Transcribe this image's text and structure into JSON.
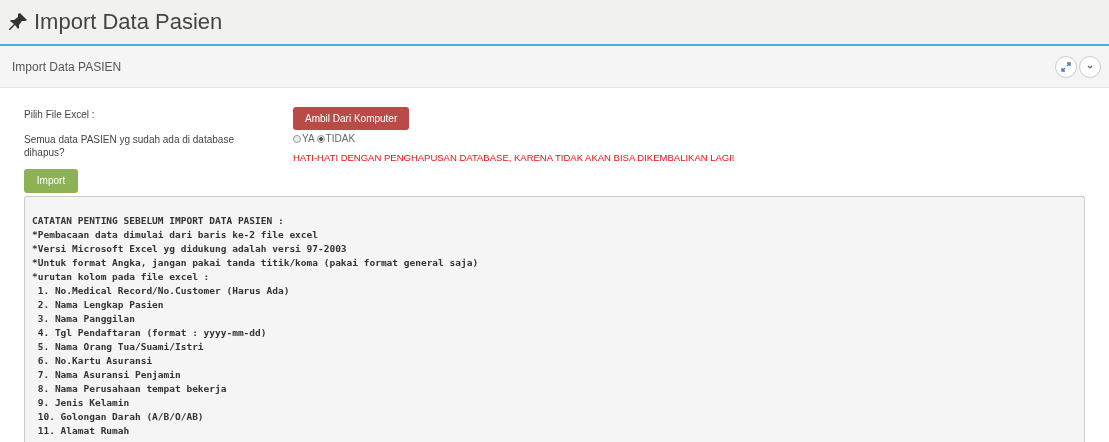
{
  "page_title": "Import Data Pasien",
  "panel": {
    "title": "Import Data PASIEN",
    "file_label": "Pilih File Excel :",
    "file_button": "Ambil Dari Komputer",
    "delete_label": "Semua data PASIEN yg sudah ada di database dihapus?",
    "delete_options": [
      {
        "label": "YA",
        "selected": false
      },
      {
        "label": "TIDAK",
        "selected": true
      }
    ],
    "warning": "HATI-HATI DENGAN PENGHAPUSAN DATABASE, KARENA TIDAK AKAN BISA DIKEMBALIKAN LAGI!",
    "import_button": "Import",
    "notes": {
      "heading": "CATATAN PENTING SEBELUM IMPORT DATA PASIEN :",
      "lines": [
        "*Pembacaan data dimulai dari baris ke-2 file excel",
        "*Versi Microsoft Excel yg didukung adalah versi 97-2003",
        "*Untuk format Angka, jangan pakai tanda titik/koma (pakai format general saja)",
        "*urutan kolom pada file excel :"
      ],
      "columns": [
        "1. No.Medical Record/No.Customer (Harus Ada)",
        "2. Nama Lengkap Pasien",
        "3. Nama Panggilan",
        "4. Tgl Pendaftaran (format : yyyy-mm-dd)",
        "5. Nama Orang Tua/Suami/Istri",
        "6. No.Kartu Asuransi",
        "7. Nama Asuransi Penjamin",
        "8. Nama Perusahaan tempat bekerja",
        "9. Jenis Kelamin",
        "10. Golongan Darah (A/B/O/AB)",
        "11. Alamat Rumah"
      ]
    }
  }
}
